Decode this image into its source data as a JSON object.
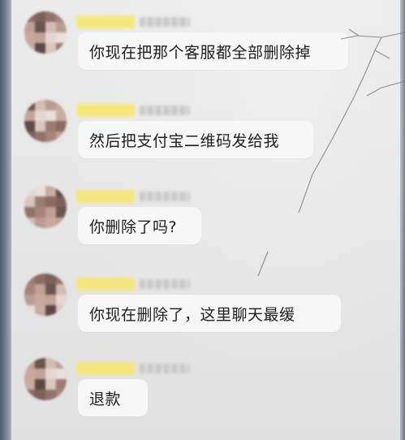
{
  "messages": [
    {
      "text": "你现在把那个客服都全部删除掉"
    },
    {
      "text": "然后把支付宝二维码发给我"
    },
    {
      "text": "你删除了吗?"
    },
    {
      "text": "你现在删除了，这里聊天最缓"
    },
    {
      "text": "退款"
    }
  ],
  "colors": {
    "bubble": "#f7f7f7",
    "name_highlight": "#f5e77e",
    "background": "#e6e6e6"
  },
  "icons": [
    "blurred-avatar"
  ]
}
